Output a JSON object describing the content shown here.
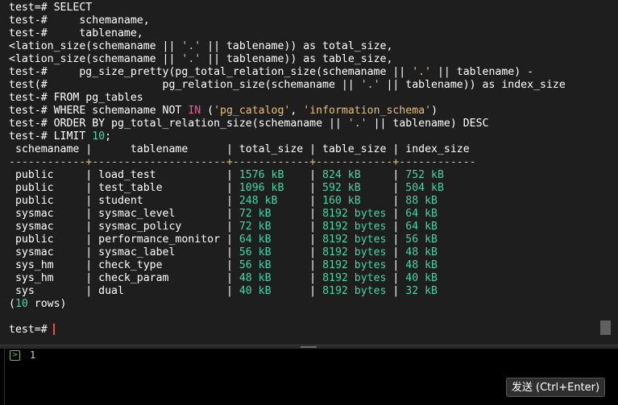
{
  "terminal": {
    "lines": [
      [
        {
          "t": "test=# SELECT"
        }
      ],
      [
        {
          "t": "test-#     schemaname,"
        }
      ],
      [
        {
          "t": "test-#     tablename,"
        }
      ],
      [
        {
          "t": "<lation_size(schemaname || "
        },
        {
          "t": "'.'",
          "c": "s"
        },
        {
          "t": " || tablename)) as total_size,"
        }
      ],
      [
        {
          "t": "<lation_size(schemaname || "
        },
        {
          "t": "'.'",
          "c": "s"
        },
        {
          "t": " || tablename)) as table_size,"
        }
      ],
      [
        {
          "t": "test-#     pg_size_pretty(pg_total_relation_size(schemaname || "
        },
        {
          "t": "'.'",
          "c": "s"
        },
        {
          "t": " || tablename) -"
        }
      ],
      [
        {
          "t": "test(#                  pg_relation_size(schemaname || "
        },
        {
          "t": "'.'",
          "c": "s"
        },
        {
          "t": " || tablename)) as index_size"
        }
      ],
      [
        {
          "t": "test-# FROM pg_tables"
        }
      ],
      [
        {
          "t": "test-# WHERE schemaname NOT "
        },
        {
          "t": "IN",
          "c": "k"
        },
        {
          "t": " ("
        },
        {
          "t": "'pg_catalog'",
          "c": "s"
        },
        {
          "t": ", "
        },
        {
          "t": "'information_schema'",
          "c": "s"
        },
        {
          "t": ")"
        }
      ],
      [
        {
          "t": "test-# ORDER BY pg_total_relation_size(schemaname || "
        },
        {
          "t": "'.'",
          "c": "s"
        },
        {
          "t": " || tablename) DESC"
        }
      ],
      [
        {
          "t": "test-# LIMIT "
        },
        {
          "t": "10",
          "c": "n"
        },
        {
          "t": ";"
        }
      ],
      [
        {
          "t": " schemaname |      tablename      | total_size | table_size | index_size"
        }
      ],
      [
        {
          "t": "------------+---------------------+------------+------------+------------",
          "c": "s"
        }
      ],
      [
        {
          "t": " public     | load_test           | "
        },
        {
          "t": "1576 kB",
          "c": "g"
        },
        {
          "t": "    | "
        },
        {
          "t": "824 kB",
          "c": "g"
        },
        {
          "t": "     | "
        },
        {
          "t": "752 kB",
          "c": "g"
        }
      ],
      [
        {
          "t": " public     | test_table          | "
        },
        {
          "t": "1096 kB",
          "c": "g"
        },
        {
          "t": "    | "
        },
        {
          "t": "592 kB",
          "c": "g"
        },
        {
          "t": "     | "
        },
        {
          "t": "504 kB",
          "c": "g"
        }
      ],
      [
        {
          "t": " public     | student             | "
        },
        {
          "t": "248 kB",
          "c": "g"
        },
        {
          "t": "     | "
        },
        {
          "t": "160 kB",
          "c": "g"
        },
        {
          "t": "     | "
        },
        {
          "t": "88 kB",
          "c": "g"
        }
      ],
      [
        {
          "t": " sysmac     | sysmac_level        | "
        },
        {
          "t": "72 kB",
          "c": "g"
        },
        {
          "t": "      | "
        },
        {
          "t": "8192 bytes",
          "c": "g"
        },
        {
          "t": " | "
        },
        {
          "t": "64 kB",
          "c": "g"
        }
      ],
      [
        {
          "t": " sysmac     | sysmac_policy       | "
        },
        {
          "t": "72 kB",
          "c": "g"
        },
        {
          "t": "      | "
        },
        {
          "t": "8192 bytes",
          "c": "g"
        },
        {
          "t": " | "
        },
        {
          "t": "64 kB",
          "c": "g"
        }
      ],
      [
        {
          "t": " public     | performance_monitor | "
        },
        {
          "t": "64 kB",
          "c": "g"
        },
        {
          "t": "      | "
        },
        {
          "t": "8192 bytes",
          "c": "g"
        },
        {
          "t": " | "
        },
        {
          "t": "56 kB",
          "c": "g"
        }
      ],
      [
        {
          "t": " sysmac     | sysmac_label        | "
        },
        {
          "t": "56 kB",
          "c": "g"
        },
        {
          "t": "      | "
        },
        {
          "t": "8192 bytes",
          "c": "g"
        },
        {
          "t": " | "
        },
        {
          "t": "48 kB",
          "c": "g"
        }
      ],
      [
        {
          "t": " sys_hm     | check_type          | "
        },
        {
          "t": "56 kB",
          "c": "g"
        },
        {
          "t": "      | "
        },
        {
          "t": "8192 bytes",
          "c": "g"
        },
        {
          "t": " | "
        },
        {
          "t": "48 kB",
          "c": "g"
        }
      ],
      [
        {
          "t": " sys_hm     | check_param         | "
        },
        {
          "t": "48 kB",
          "c": "g"
        },
        {
          "t": "      | "
        },
        {
          "t": "8192 bytes",
          "c": "g"
        },
        {
          "t": " | "
        },
        {
          "t": "40 kB",
          "c": "g"
        }
      ],
      [
        {
          "t": " sys        | dual                | "
        },
        {
          "t": "40 kB",
          "c": "g"
        },
        {
          "t": "      | "
        },
        {
          "t": "8192 bytes",
          "c": "g"
        },
        {
          "t": " | "
        },
        {
          "t": "32 kB",
          "c": "g"
        }
      ],
      [
        {
          "t": "("
        },
        {
          "t": "10",
          "c": "n"
        },
        {
          "t": " rows)"
        }
      ],
      [
        {
          "t": ""
        }
      ],
      [
        {
          "t": "test=# "
        }
      ]
    ]
  },
  "editor": {
    "line_number": "1",
    "prompt_icon": "terminal-icon"
  },
  "actions": {
    "send_label": "发送 (Ctrl+Enter)"
  },
  "colors": {
    "background": "#1e1e1e",
    "text": "#ffffff",
    "string": "#e5c07b",
    "keyword": "#f7569b",
    "number": "#3fd6a6",
    "value": "#3fd6a6",
    "cursor": "#f24b4b"
  }
}
